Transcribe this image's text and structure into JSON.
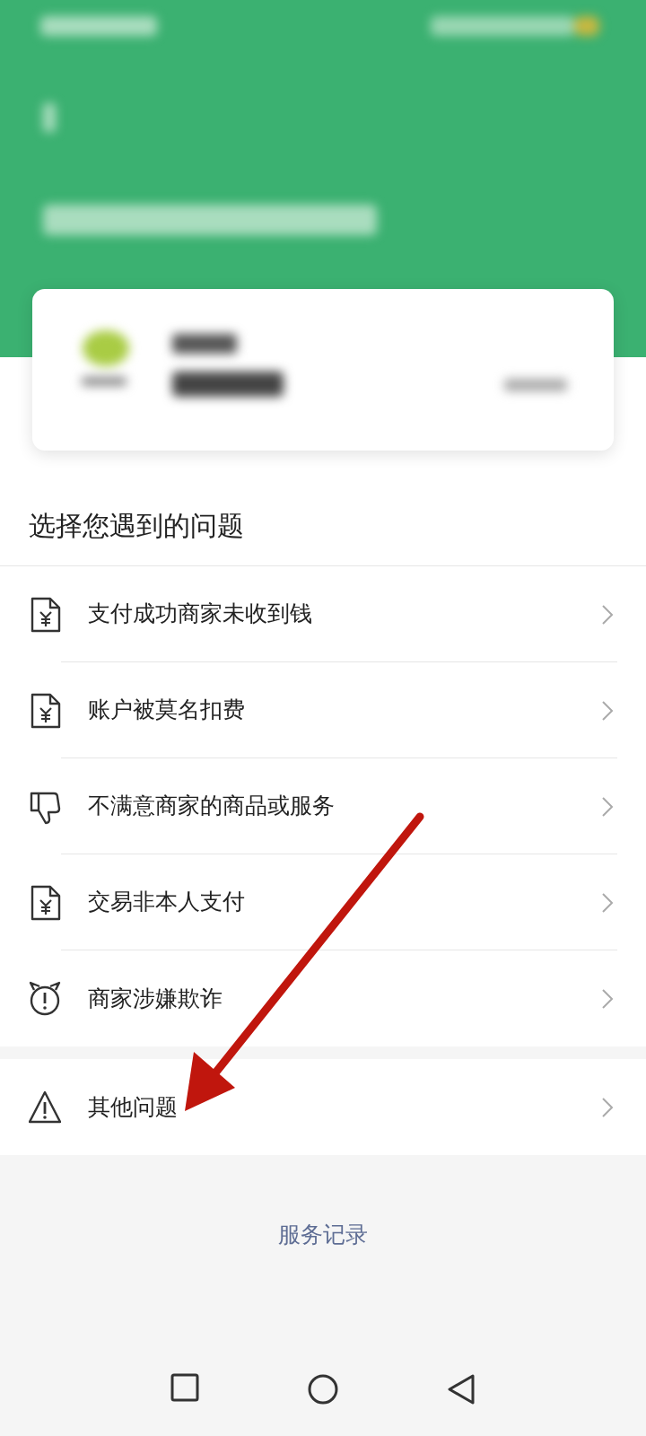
{
  "section_title": "选择您遇到的问题",
  "problems": [
    {
      "kind": "receipt",
      "label": "支付成功商家未收到钱"
    },
    {
      "kind": "receipt",
      "label": "账户被莫名扣费"
    },
    {
      "kind": "dislike",
      "label": "不满意商家的商品或服务"
    },
    {
      "kind": "receipt",
      "label": "交易非本人支付"
    },
    {
      "kind": "alert",
      "label": "商家涉嫌欺诈"
    }
  ],
  "other": {
    "kind": "warning",
    "label": "其他问题"
  },
  "service_record": "服务记录"
}
